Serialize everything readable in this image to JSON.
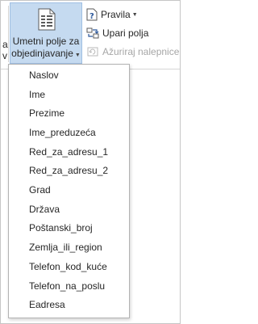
{
  "ribbon": {
    "cut_text_1": "a",
    "cut_text_2": "v",
    "merge_field": {
      "label_line1": "Umetni polje za",
      "label_line2": "objedinjavanje",
      "icon": "insert-merge-field-icon"
    },
    "rules_label": "Pravila",
    "match_fields_label": "Upari polja",
    "update_labels_label": "Ažuriraj nalepnice"
  },
  "menu": {
    "items": [
      "Naslov",
      "Ime",
      "Prezime",
      "Ime_preduzeća",
      "Red_za_adresu_1",
      "Red_za_adresu_2",
      "Grad",
      "Država",
      "Poštanski_broj",
      "Zemlja_ili_region",
      "Telefon_kod_kuće",
      "Telefon_na_poslu",
      "Eadresa"
    ]
  },
  "colors": {
    "selected_button_bg": "#c5daf0",
    "selected_button_border": "#9fbfe3",
    "disabled_text": "#a6a6a6",
    "accent_blue": "#2b579a"
  }
}
